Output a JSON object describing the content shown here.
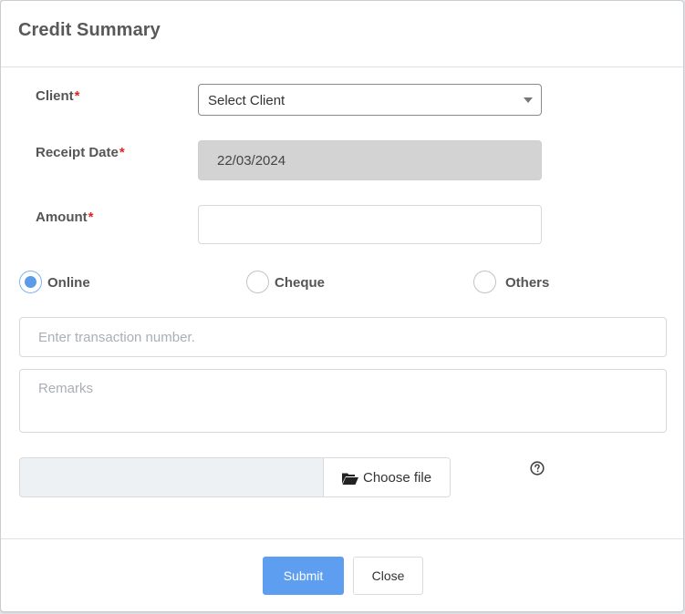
{
  "modal": {
    "title": "Credit Summary"
  },
  "form": {
    "client": {
      "label": "Client",
      "required_mark": "*",
      "selected": "Select Client"
    },
    "receipt_date": {
      "label": "Receipt Date",
      "required_mark": "*",
      "value": "22/03/2024"
    },
    "amount": {
      "label": "Amount",
      "required_mark": "*",
      "value": ""
    },
    "payment_mode": {
      "options": [
        {
          "label": "Online",
          "checked": true
        },
        {
          "label": "Cheque",
          "checked": false
        },
        {
          "label": "Others",
          "checked": false
        }
      ]
    },
    "transaction_number": {
      "placeholder": "Enter transaction number.",
      "value": ""
    },
    "remarks": {
      "placeholder": "Remarks",
      "value": ""
    },
    "file": {
      "button_label": "Choose file",
      "icon": "folder-open-icon"
    },
    "help": {
      "icon": "question-circle-icon"
    }
  },
  "footer": {
    "submit_label": "Submit",
    "close_label": "Close"
  },
  "colors": {
    "accent": "#5d9ef0",
    "required": "#e02424",
    "readonly_bg": "#d3d3d3"
  }
}
